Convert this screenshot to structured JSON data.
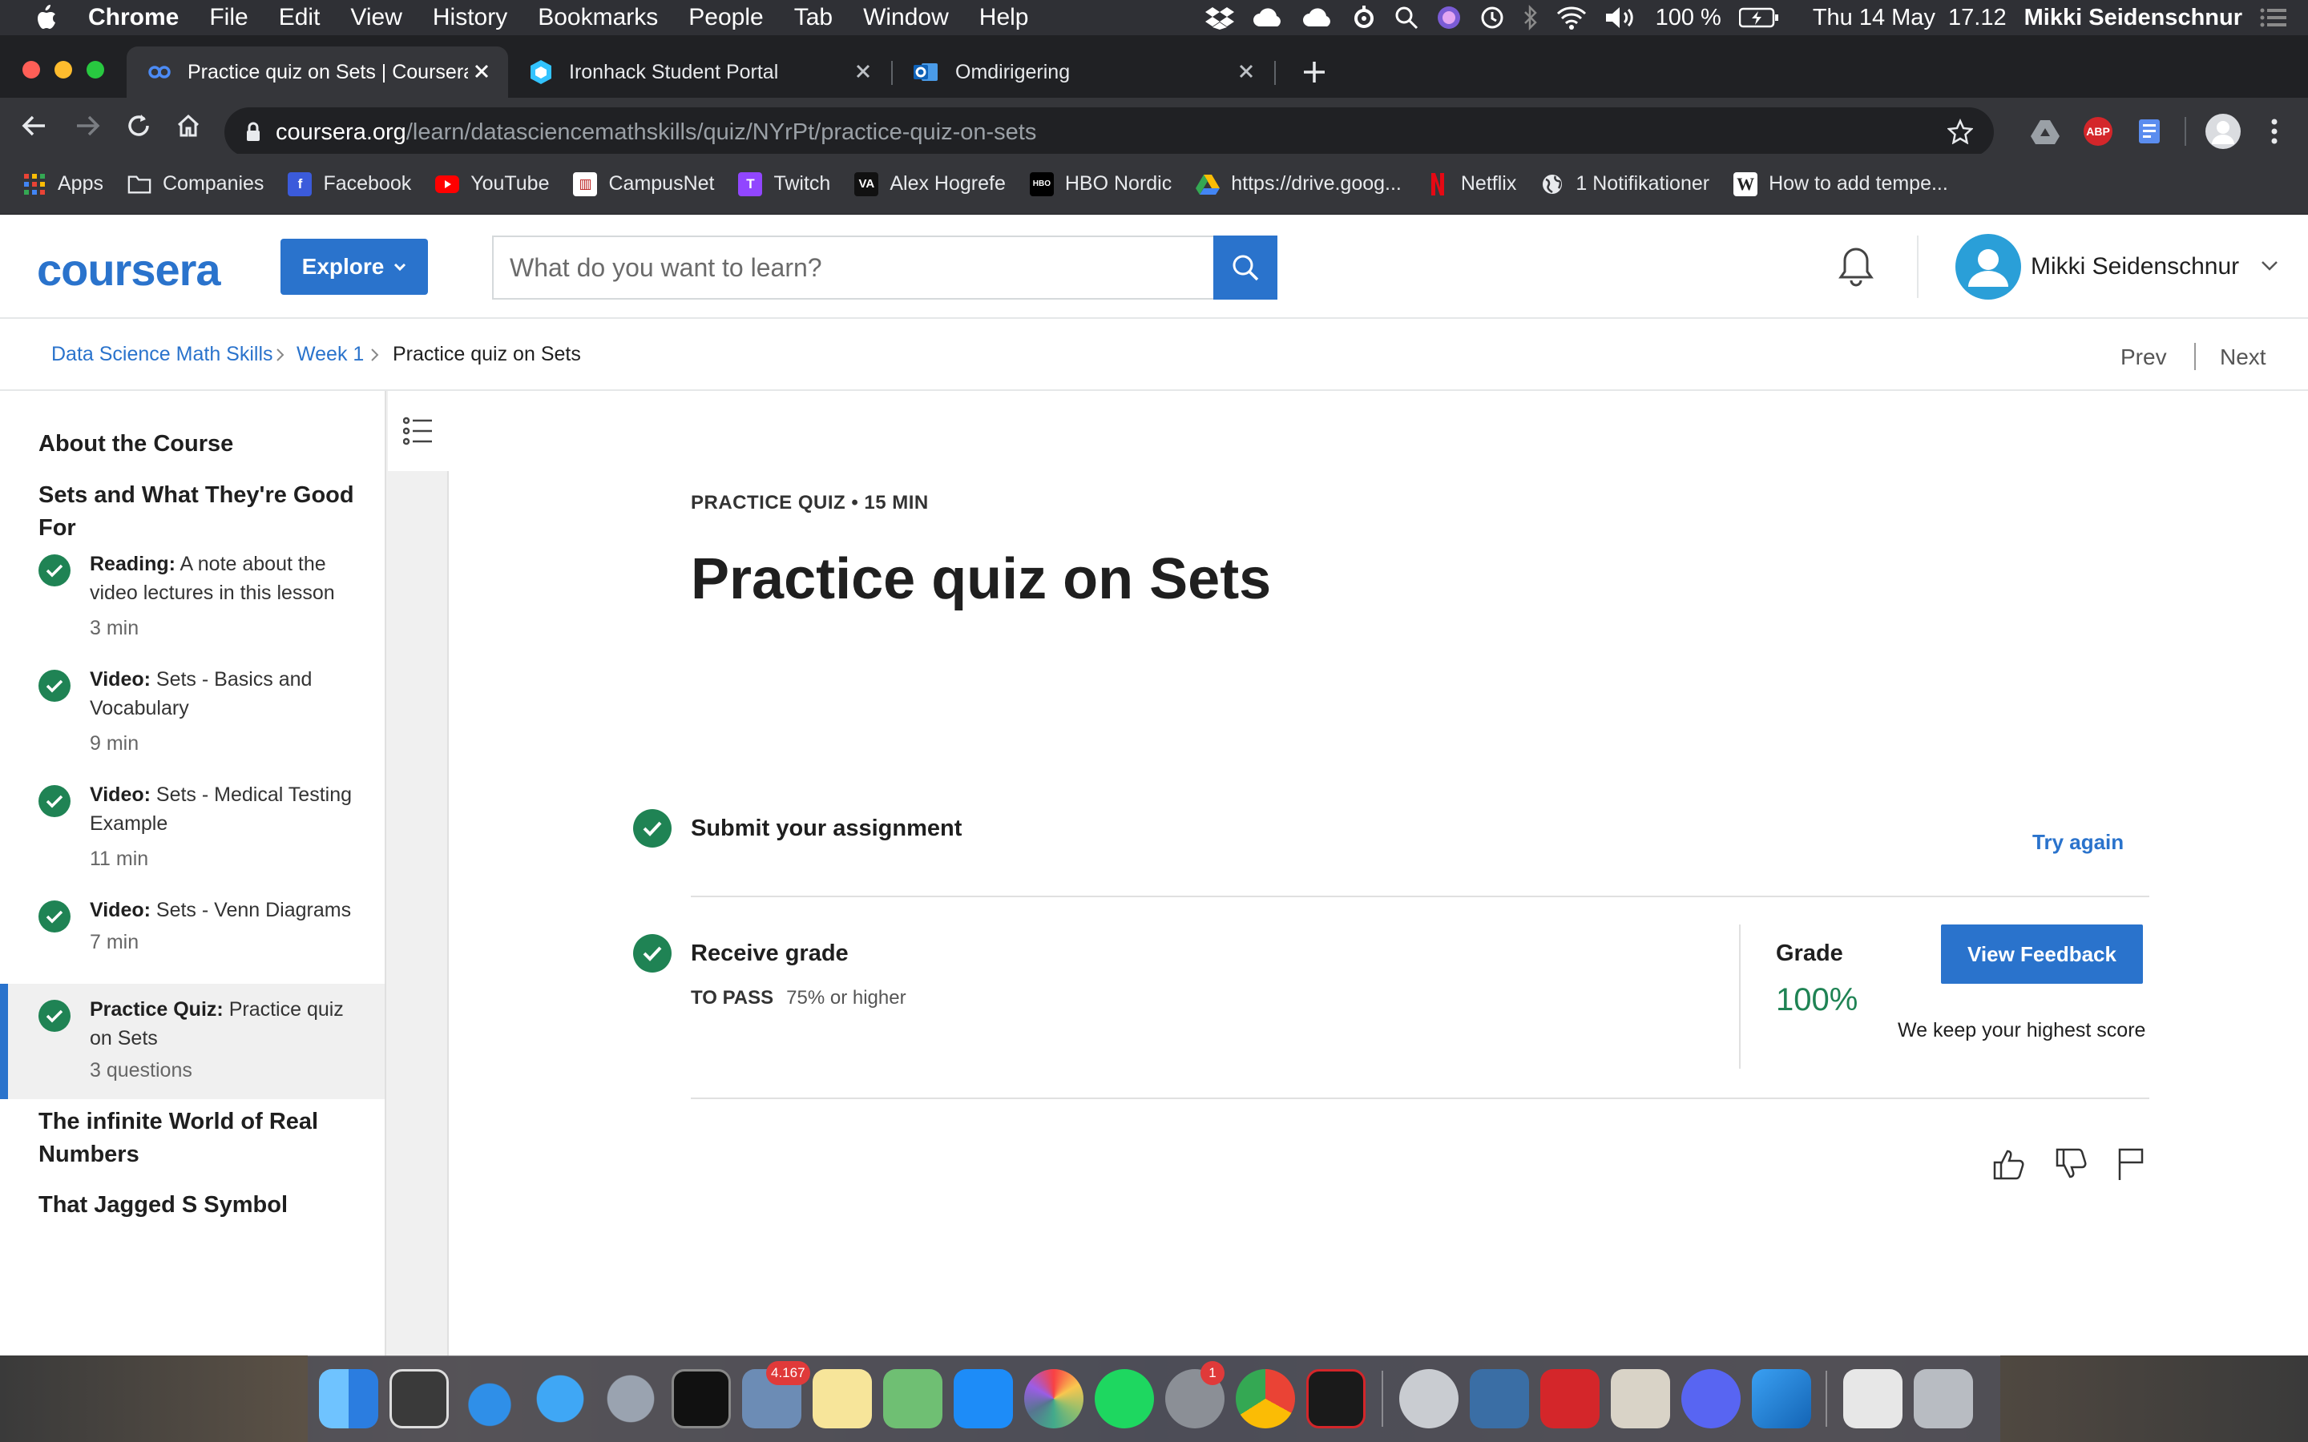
{
  "menubar": {
    "app": "Chrome",
    "items": [
      "File",
      "Edit",
      "View",
      "History",
      "Bookmarks",
      "People",
      "Tab",
      "Window",
      "Help"
    ],
    "battery": "100 %",
    "datetime": "Thu 14 May  17.12",
    "user": "Mikki Seidenschnur"
  },
  "tabs": [
    {
      "title": "Practice quiz on Sets | Coursera"
    },
    {
      "title": "Ironhack Student Portal"
    },
    {
      "title": "Omdirigering"
    }
  ],
  "omnibox": {
    "host": "coursera.org",
    "path": "/learn/datasciencemathskills/quiz/NYrPt/practice-quiz-on-sets"
  },
  "extensions": {
    "abp": "ABP"
  },
  "bookmarks": [
    {
      "label": "Apps",
      "icon": "apps-grid-icon"
    },
    {
      "label": "Companies",
      "icon": "folder-icon"
    },
    {
      "label": "Facebook",
      "icon": "facebook-icon"
    },
    {
      "label": "YouTube",
      "icon": "youtube-icon"
    },
    {
      "label": "CampusNet",
      "icon": "campusnet-icon"
    },
    {
      "label": "Twitch",
      "icon": "twitch-icon"
    },
    {
      "label": "Alex Hogrefe",
      "icon": "va-icon"
    },
    {
      "label": "HBO Nordic",
      "icon": "hbo-icon"
    },
    {
      "label": "https://drive.goog...",
      "icon": "drive-icon"
    },
    {
      "label": "Netflix",
      "icon": "netflix-icon"
    },
    {
      "label": "1 Notifikationer",
      "icon": "globe-icon"
    },
    {
      "label": "How to add tempe...",
      "icon": "wikipedia-icon"
    }
  ],
  "bookmark_glyphs": {
    "va": "VA",
    "hbo": "HBO",
    "wiki": "W",
    "campus": "▥",
    "twitch": "T",
    "facebook": "f"
  },
  "header": {
    "logo": "coursera",
    "explore": "Explore",
    "search_placeholder": "What do you want to learn?",
    "user": "Mikki Seidenschnur"
  },
  "breadcrumbs": [
    "Data Science Math Skills",
    "Week 1",
    "Practice quiz on Sets"
  ],
  "nav": {
    "prev": "Prev",
    "next": "Next"
  },
  "sidebar": {
    "sections": [
      "About the Course",
      "Sets and What They're Good For",
      "The infinite World of Real Numbers",
      "That Jagged S Symbol"
    ],
    "items": [
      {
        "type": "Reading:",
        "title": "A note about the video lectures in this lesson",
        "meta": "3 min",
        "completed": true
      },
      {
        "type": "Video:",
        "title": "Sets - Basics and Vocabulary",
        "meta": "9 min",
        "completed": true
      },
      {
        "type": "Video:",
        "title": "Sets - Medical Testing Example",
        "meta": "11 min",
        "completed": true
      },
      {
        "type": "Video:",
        "title": "Sets - Venn Diagrams",
        "meta": "7 min",
        "completed": true
      },
      {
        "type": "Practice Quiz:",
        "title": "Practice quiz on Sets",
        "meta": "3 questions",
        "completed": true,
        "active": true
      }
    ]
  },
  "quiz": {
    "kicker": "PRACTICE QUIZ • 15 MIN",
    "title": "Practice quiz on Sets",
    "submit_label": "Submit your assignment",
    "try_again": "Try again",
    "receive_label": "Receive grade",
    "to_pass_label": "TO PASS",
    "to_pass_value": "75% or higher",
    "grade_label": "Grade",
    "grade_value": "100%",
    "view_feedback": "View Feedback",
    "keep_note": "We keep your highest score"
  },
  "dock": {
    "mail_badge": "4.167",
    "prefs_badge": "1"
  },
  "colors": {
    "brand": "#2a73cc",
    "success": "#1f8354"
  }
}
